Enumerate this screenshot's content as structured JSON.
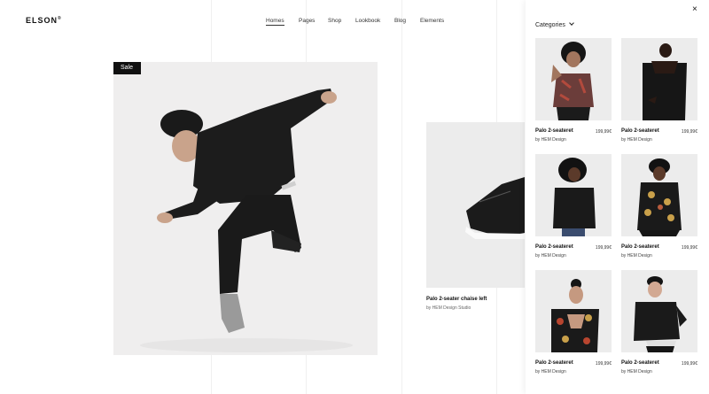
{
  "header": {
    "logo": "ELSON",
    "logo_mark": "®",
    "nav": [
      "Homes",
      "Pages",
      "Shop",
      "Lookbook",
      "Blog",
      "Elements"
    ]
  },
  "hero": {
    "badge": "Sale"
  },
  "secondary_product": {
    "title": "Palo 2-seater chaise left",
    "subtitle": "by HEM Design Studio"
  },
  "panel": {
    "heading": "Categories",
    "close_glyph": "×",
    "products": [
      {
        "name": "Palo 2-seateret",
        "price": "199,99€",
        "brand": "by HEM Design"
      },
      {
        "name": "Palo 2-seateret",
        "price": "199,99€",
        "brand": "by HEM Design"
      },
      {
        "name": "Palo 2-seateret",
        "price": "199,99€",
        "brand": "by HEM Design"
      },
      {
        "name": "Palo 2-seateret",
        "price": "199,99€",
        "brand": "by HEM Design"
      },
      {
        "name": "Palo 2-seateret",
        "price": "199,99€",
        "brand": "by HEM Design"
      },
      {
        "name": "Palo 2-seateret",
        "price": "199,99€",
        "brand": "by HEM Design"
      }
    ]
  }
}
